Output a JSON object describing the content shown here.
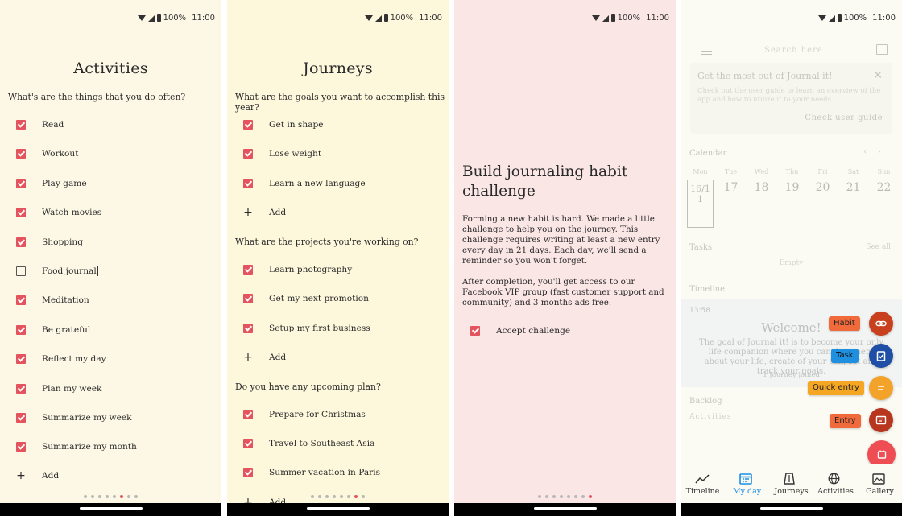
{
  "status_bar": {
    "battery": "100%",
    "time": "11:00"
  },
  "activities": {
    "title": "Activities",
    "question": "What's are the things that you do often?",
    "items": [
      {
        "label": "Read",
        "checked": true
      },
      {
        "label": "Workout",
        "checked": true
      },
      {
        "label": "Play game",
        "checked": true
      },
      {
        "label": "Watch movies",
        "checked": true
      },
      {
        "label": "Shopping",
        "checked": true
      },
      {
        "label": "Food journal",
        "checked": false
      },
      {
        "label": "Meditation",
        "checked": true
      },
      {
        "label": "Be grateful",
        "checked": true
      },
      {
        "label": "Reflect my day",
        "checked": true
      },
      {
        "label": "Plan my week",
        "checked": true
      },
      {
        "label": "Summarize my week",
        "checked": true
      },
      {
        "label": "Summarize my month",
        "checked": true
      }
    ],
    "add_label": "Add",
    "page_dots": 8,
    "active_dot": 5
  },
  "journeys": {
    "title": "Journeys",
    "sections": [
      {
        "question": "What are the goals you want to accomplish this year?",
        "items": [
          "Get in shape",
          "Lose weight",
          "Learn a new language"
        ],
        "add_label": "Add"
      },
      {
        "question": "What are the projects you're working on?",
        "items": [
          "Learn photography",
          "Get my next promotion",
          "Setup my first business"
        ],
        "add_label": "Add"
      },
      {
        "question": "Do you have any upcoming plan?",
        "items": [
          "Prepare for Christmas",
          "Travel to Southeast Asia",
          "Summer vacation in Paris"
        ],
        "add_label": "Add"
      }
    ],
    "page_dots": 8,
    "active_dot": 6
  },
  "challenge": {
    "title": "Build journaling habit challenge",
    "paragraph1": "Forming a new habit is hard. We made a little challenge to help you on the journey. This challenge requires writing at least a new entry every day in 21 days. Each day, we'll send a reminder so you won't forget.",
    "paragraph2": "After completion, you'll get access to our Facebook VIP group (fast customer support and community) and 3 months ads free.",
    "accept_label": "Accept challenge",
    "page_dots": 8,
    "active_dot": 7
  },
  "myday": {
    "search_placeholder": "Search here",
    "card": {
      "title": "Get the most out of Journal it!",
      "body": "Check out the user guide to learn an overview of the app and how to utilize it to your needs.",
      "button": "Check user guide"
    },
    "calendar_label": "Calendar",
    "week": [
      {
        "name": "Mon",
        "num": "16/1"
      },
      {
        "name": "Tue",
        "num": "17"
      },
      {
        "name": "Wed",
        "num": "18"
      },
      {
        "name": "Thu",
        "num": "19"
      },
      {
        "name": "Fri",
        "num": "20"
      },
      {
        "name": "Sat",
        "num": "21"
      },
      {
        "name": "Sun",
        "num": "22"
      }
    ],
    "today_count": "1",
    "tasks_label": "Tasks",
    "see_all": "See all",
    "tasks_empty": "Empty",
    "timeline_label": "Timeline",
    "timeline_time": "13:58",
    "welcome_title": "Welcome!",
    "welcome_body": "The goal of Journal it! is to become your only life companion where you can document about your life, create of your self, set and track your goals.",
    "welcome_footer": "1 Journey joined",
    "backlog_label": "Backlog",
    "backlog_sub": "Activities",
    "fabs": {
      "habit": "Habit",
      "task": "Task",
      "quick_entry": "Quick entry",
      "entry": "Entry"
    },
    "fab_colors": {
      "habit": "#c8401e",
      "task": "#1f4ea6",
      "quick_entry": "#f3a32a",
      "entry": "#b8351e",
      "main": "#ef4d54"
    },
    "nav": [
      {
        "label": "Timeline",
        "icon": "trend-icon",
        "active": false
      },
      {
        "label": "My day",
        "icon": "calendar-icon",
        "active": true
      },
      {
        "label": "Journeys",
        "icon": "journey-icon",
        "active": false
      },
      {
        "label": "Activities",
        "icon": "globe-icon",
        "active": false
      },
      {
        "label": "Gallery",
        "icon": "gallery-icon",
        "active": false
      }
    ]
  }
}
